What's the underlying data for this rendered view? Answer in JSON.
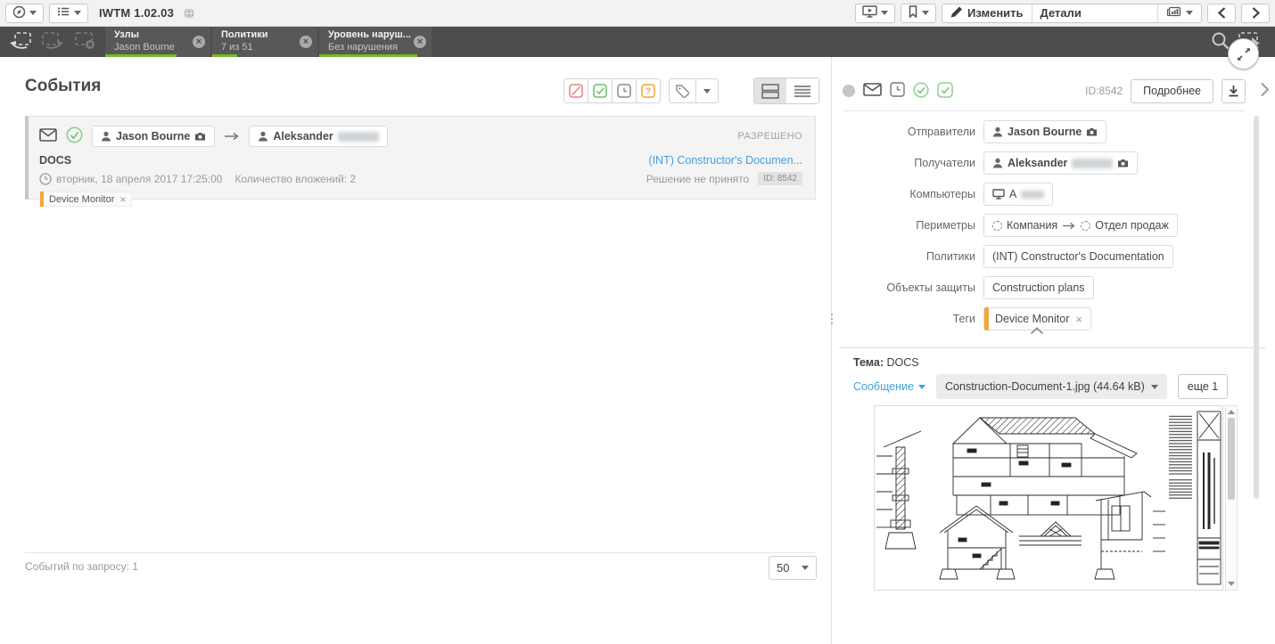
{
  "app": {
    "title": "IWTM 1.02.03"
  },
  "topbar": {
    "edit_label": "Изменить",
    "details_label": "Детали"
  },
  "filterbar": {
    "chips": [
      {
        "title": "Узлы",
        "value": "Jason Bourne"
      },
      {
        "title": "Политики",
        "value": "7 из 51"
      },
      {
        "title": "Уровень наруш...",
        "value": "Без нарушения"
      }
    ]
  },
  "events": {
    "title": "События",
    "card": {
      "sender": "Jason Bourne",
      "recipient": "Aleksander",
      "verdict": "РАЗРЕШЕНО",
      "subject": "DOCS",
      "policy_link": "(INT) Constructor's Documen...",
      "date": "вторник, 18 апреля 2017 17:25:00",
      "attachments_count": "Количество вложений: 2",
      "decision": "Решение не принято",
      "id_badge": "ID: 8542",
      "tag": "Device Monitor"
    },
    "footer": {
      "count": "Событий по запросу: 1",
      "page_size": "50"
    }
  },
  "details": {
    "id": "ID:8542",
    "more_button": "Подробнее",
    "fields": {
      "senders": {
        "label": "Отправители",
        "value": "Jason Bourne"
      },
      "recipients": {
        "label": "Получатели",
        "value": "Aleksander"
      },
      "computers": {
        "label": "Компьютеры",
        "value": "A"
      },
      "perimeters": {
        "label": "Периметры",
        "from": "Компания",
        "to": "Отдел продаж"
      },
      "policies": {
        "label": "Политики",
        "value": "(INT) Constructor's Documentation"
      },
      "objects": {
        "label": "Объекты защиты",
        "value": "Construction plans"
      },
      "tags": {
        "label": "Теги",
        "value": "Device Monitor"
      }
    },
    "subject_label": "Тема:",
    "subject": "DOCS",
    "message_label": "Сообщение",
    "attachment_label": "Construction-Document-1.jpg (44.64 kB)",
    "more_attachments": "еще 1"
  },
  "colors": {
    "accent_green": "#76b82a",
    "tag_orange": "#f3a63b",
    "link_blue": "#449fdb",
    "block_red": "#e98080",
    "check_green": "#6abf69",
    "question_orange": "#f0a236",
    "darkbar_gray": "#4d4d4d"
  }
}
